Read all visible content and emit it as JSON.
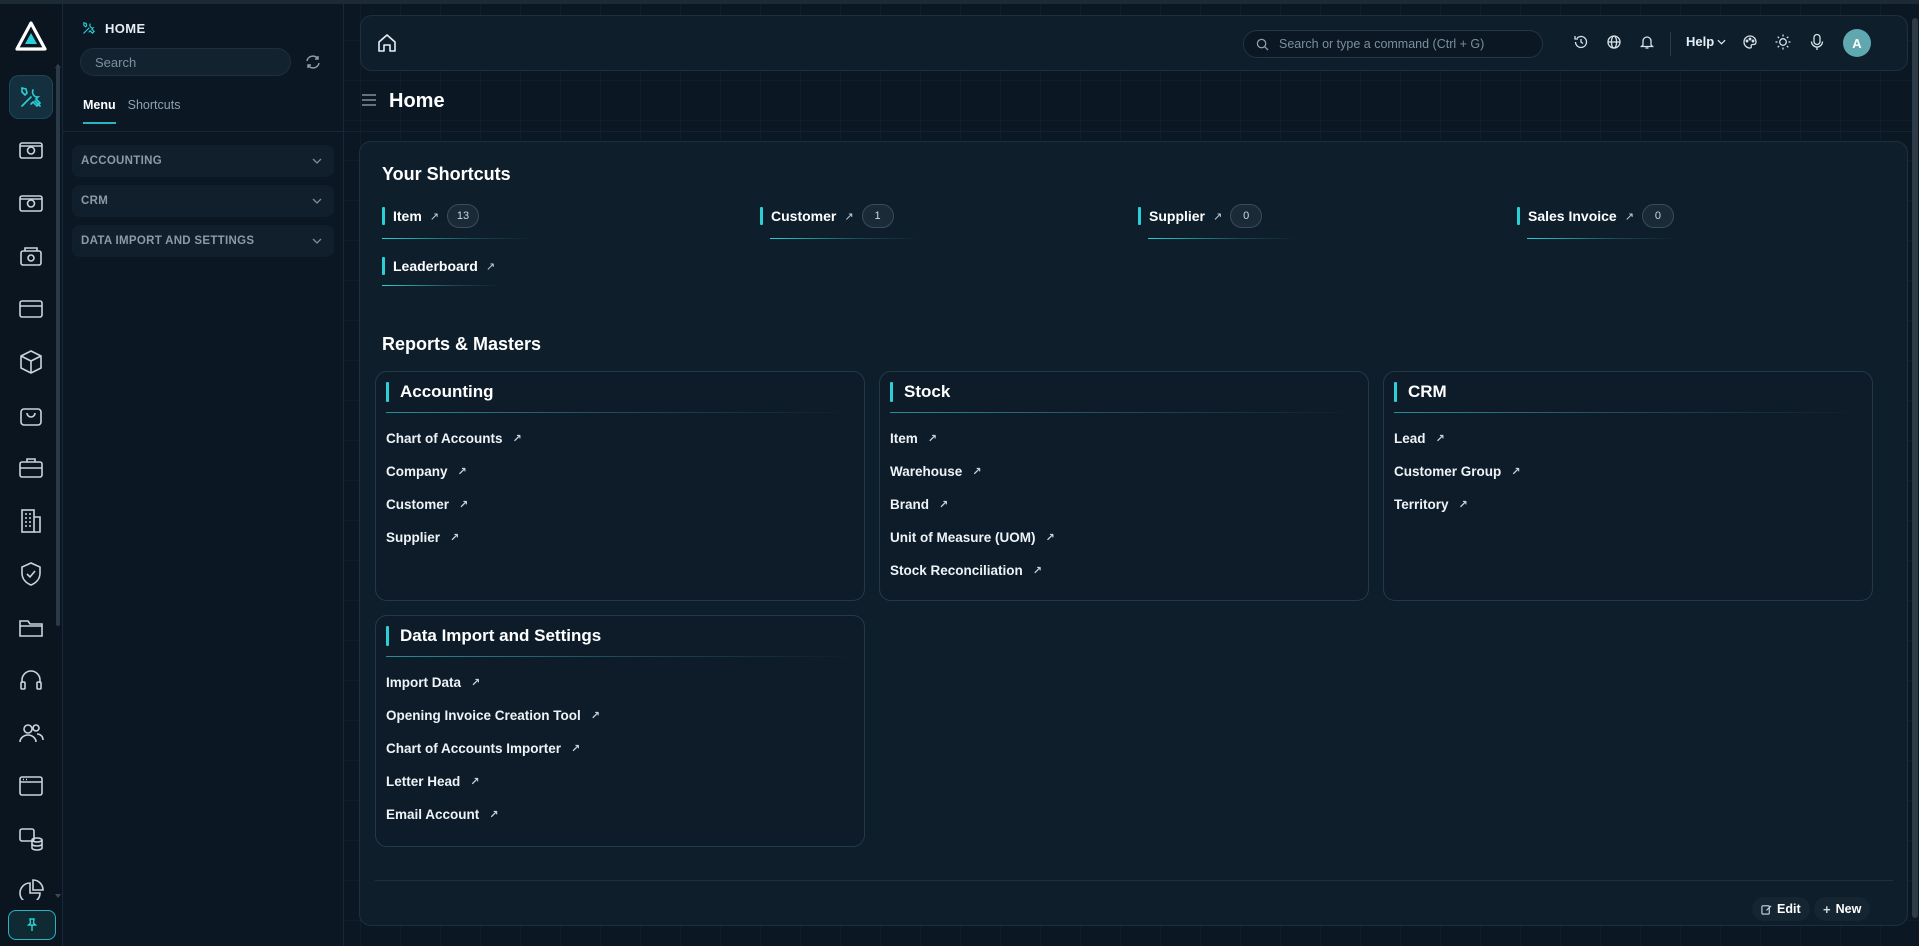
{
  "sidebar": {
    "title": "HOME",
    "search_placeholder": "Search",
    "tabs": [
      "Menu",
      "Shortcuts"
    ],
    "groups": [
      "ACCOUNTING",
      "CRM",
      "DATA IMPORT AND SETTINGS"
    ]
  },
  "rail": {
    "icons": [
      "tools-icon",
      "money-eye-icon",
      "money-eye-icon-2",
      "cash-register-icon",
      "card-icon",
      "box-icon",
      "shopping-bag-icon",
      "briefcase-icon",
      "building-icon",
      "shield-check-icon",
      "folder-icon",
      "headset-icon",
      "users-icon",
      "window-icon",
      "database-icon",
      "pie-chart-icon"
    ],
    "active": "tools-icon"
  },
  "topbar": {
    "search_placeholder": "Search or type a command (Ctrl + G)",
    "help_label": "Help",
    "avatar_initial": "A"
  },
  "page": {
    "title": "Home"
  },
  "shortcuts": {
    "title": "Your Shortcuts",
    "items": [
      {
        "label": "Item",
        "count": "13"
      },
      {
        "label": "Customer",
        "count": "1"
      },
      {
        "label": "Supplier",
        "count": "0"
      },
      {
        "label": "Sales Invoice",
        "count": "0"
      },
      {
        "label": "Leaderboard",
        "count": ""
      }
    ]
  },
  "reports": {
    "title": "Reports & Masters",
    "cards": [
      {
        "title": "Accounting",
        "links": [
          "Chart of Accounts",
          "Company",
          "Customer",
          "Supplier"
        ]
      },
      {
        "title": "Stock",
        "links": [
          "Item",
          "Warehouse",
          "Brand",
          "Unit of Measure (UOM)",
          "Stock Reconciliation"
        ]
      },
      {
        "title": "CRM",
        "links": [
          "Lead",
          "Customer Group",
          "Territory"
        ]
      },
      {
        "title": "Data Import and Settings",
        "links": [
          "Import Data",
          "Opening Invoice Creation Tool",
          "Chart of Accounts Importer",
          "Letter Head",
          "Email Account"
        ]
      }
    ]
  },
  "footer": {
    "edit_label": "Edit",
    "new_label": "New"
  },
  "colors": {
    "accent": "#2bd0d6",
    "background": "#0b1824",
    "card": "#0e1e2b"
  }
}
